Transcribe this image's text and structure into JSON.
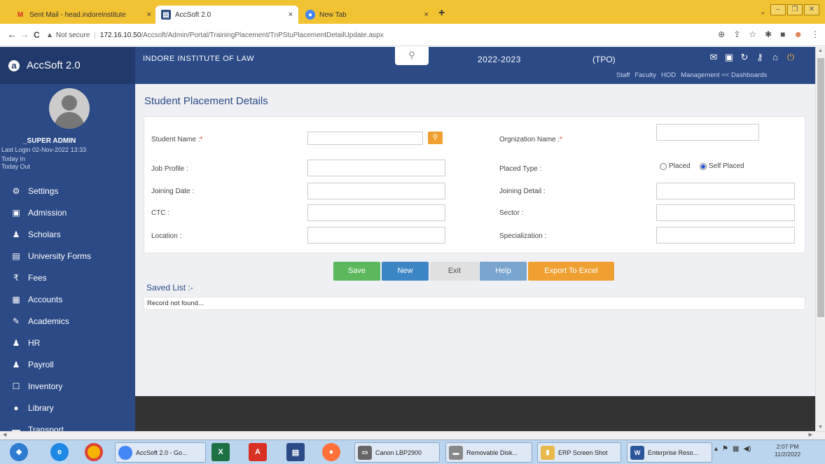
{
  "browser": {
    "tabs": [
      {
        "label": "Sent Mail - head.indoreinstitute",
        "icon": "gmail-icon",
        "close": "×"
      },
      {
        "label": "AccSoft 2.0",
        "icon": "accsoft-favicon",
        "close": "×"
      },
      {
        "label": "New Tab",
        "icon": "chrome-icon",
        "close": "×"
      }
    ],
    "new_tab": "+",
    "nav": {
      "back": "←",
      "forward": "→",
      "reload": "C"
    },
    "security": "Not secure",
    "url_host": "172.16.10.50",
    "url_path": "/Accsoft/Admin/Portal/TrainingPlacement/TnPStuPlacementDetailUpdate.aspx"
  },
  "header": {
    "brand": "AccSoft 2.0",
    "institute": "INDORE INSTITUTE OF LAW",
    "session": "2022-2023",
    "role": "(TPO)",
    "dashboards": [
      "Staff",
      "Faculty",
      "HOD",
      "Management << Dashboards"
    ]
  },
  "user": {
    "name": "_SUPER ADMIN",
    "last_login": "Last Login  02-Nov-2022 13:33",
    "today_in": "Today In",
    "today_out": "Today Out"
  },
  "sidebar": {
    "items": [
      {
        "label": "Settings",
        "icon": "gear-icon"
      },
      {
        "label": "Admission",
        "icon": "admission-icon"
      },
      {
        "label": "Scholars",
        "icon": "user-icon"
      },
      {
        "label": "University Forms",
        "icon": "form-icon"
      },
      {
        "label": "Fees",
        "icon": "rupee-icon"
      },
      {
        "label": "Accounts",
        "icon": "ledger-icon"
      },
      {
        "label": "Academics",
        "icon": "pen-icon"
      },
      {
        "label": "HR",
        "icon": "users-icon"
      },
      {
        "label": "Payroll",
        "icon": "users-icon"
      },
      {
        "label": "Inventory",
        "icon": "inventory-icon"
      },
      {
        "label": "Library",
        "icon": "library-icon"
      },
      {
        "label": "Transport",
        "icon": "bus-icon"
      }
    ]
  },
  "page": {
    "title": "Student Placement Details",
    "required_mark": "*",
    "form": {
      "student_name_label": "Student Name :",
      "student_name_value": "",
      "org_name_label": "Orgnization Name :",
      "org_name_value": "",
      "job_profile_label": "Job Profile :",
      "placed_type_label": "Placed Type :",
      "placed_options": [
        "Placed",
        "Self Placed"
      ],
      "placed_selected": "Self Placed",
      "joining_date_label": "Joining Date :",
      "joining_detail_label": "Joining Detail :",
      "ctc_label": "CTC :",
      "sector_label": "Sector :",
      "location_label": "Location :",
      "specialization_label": "Specialization :"
    },
    "buttons": {
      "save": "Save",
      "new": "New",
      "exit": "Exit",
      "help": "Help",
      "export": "Export To Excel"
    },
    "saved_list_title": "Saved List :-",
    "no_record": "Record not found..."
  },
  "taskbar": {
    "tasks": [
      "AccSoft 2.0 - Go...",
      "Canon LBP2900",
      "Removable Disk...",
      "ERP Screen Shot",
      "Enterprise Reso..."
    ],
    "time": "2:07 PM",
    "date": "11/2/2022"
  },
  "colors": {
    "header": "#2b4a86",
    "save": "#5cb85c",
    "new": "#3d86c6",
    "exit": "#e0e0e0",
    "help": "#7aa5cf",
    "export": "#f0a030"
  }
}
